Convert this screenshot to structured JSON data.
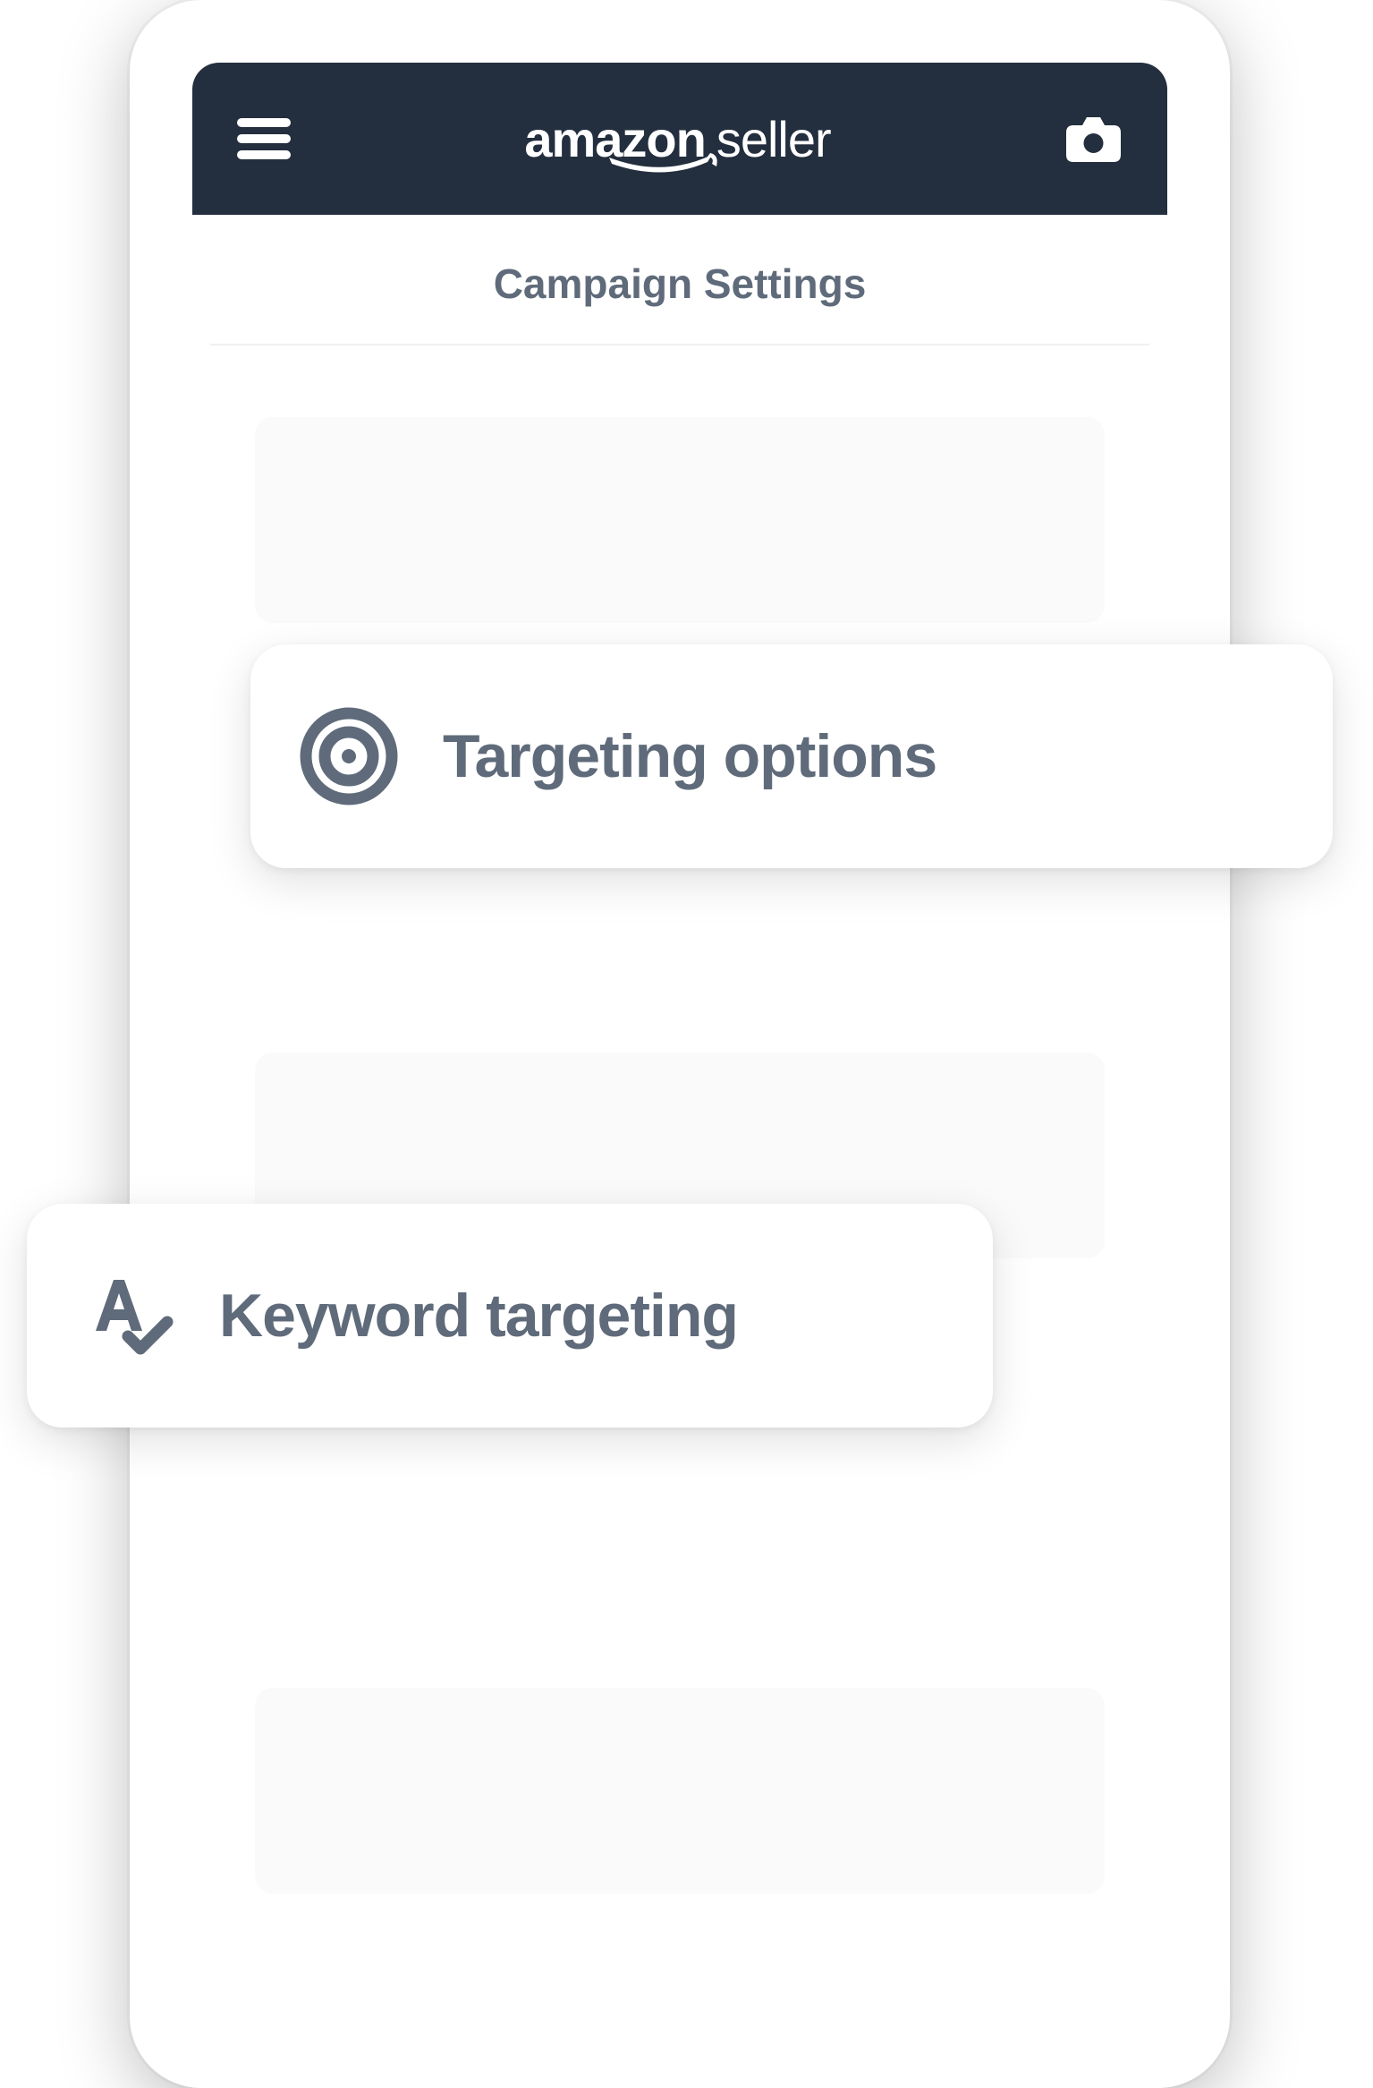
{
  "header": {
    "logo_brand": "amazon",
    "logo_suffix": "seller"
  },
  "page": {
    "title": "Campaign Settings"
  },
  "cards": {
    "targeting_options": {
      "label": "Targeting options"
    },
    "keyword_targeting": {
      "label": "Keyword targeting"
    }
  },
  "colors": {
    "header_bg": "#232f3e",
    "text_muted": "#5f6b7a",
    "placeholder": "#fafafa"
  }
}
